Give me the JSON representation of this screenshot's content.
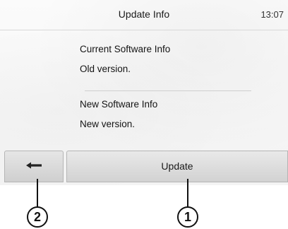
{
  "header": {
    "title": "Update Info",
    "clock": "13:07"
  },
  "current": {
    "heading": "Current Software Info",
    "version": "Old version."
  },
  "new": {
    "heading": "New Software Info",
    "version": "New version."
  },
  "buttons": {
    "back_icon": "back-arrow-icon",
    "update_label": "Update"
  },
  "callouts": {
    "back": "2",
    "update": "1"
  }
}
